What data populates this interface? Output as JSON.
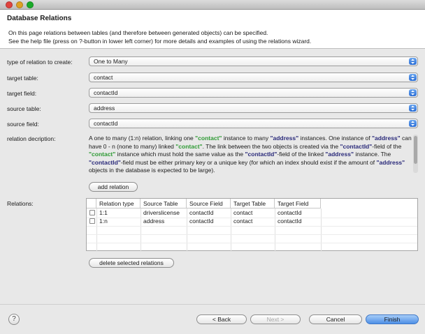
{
  "window": {
    "title": ""
  },
  "header": {
    "title": "Database Relations",
    "desc_line1": "On this page relations between tables (and therefore between generated objects) can be specified.",
    "desc_line2": "See the help file (press on ?-button in lower left corner) for more details and examples of using the relations wizard."
  },
  "form": {
    "relation_type": {
      "label": "type of relation to create:",
      "value": "One to Many"
    },
    "target_table": {
      "label": "target table:",
      "value": "contact"
    },
    "target_field": {
      "label": "target field:",
      "value": "contactId"
    },
    "source_table": {
      "label": "source table:",
      "value": "address"
    },
    "source_field": {
      "label": "source field:",
      "value": "contactId"
    },
    "description_label": "relation decription:"
  },
  "description": {
    "p1": "A one to many (1:n) relation, linking one ",
    "contact": "\"contact\"",
    "p2": " instance to many ",
    "address": "\"address\"",
    "p3": " instances. One instance of ",
    "p4": " can have 0 - n (none to many) linked ",
    "p5": ". The link between the two objects is created via the ",
    "contactid": "\"contactId\"",
    "p6": "-field of the ",
    "p7": " instance which must hold the same value as the ",
    "p8": "-field of the linked ",
    "p9": " instance. The ",
    "p10": "-field must be either primary key or a unique key (for which an index should exist if the amount of ",
    "p11": " objects in the database is expected to be large)."
  },
  "buttons": {
    "add_relation": "add relation",
    "delete_selected": "delete selected relations",
    "back": "< Back",
    "next": "Next >",
    "cancel": "Cancel",
    "finish": "Finish",
    "help": "?"
  },
  "relations": {
    "label": "Relations:",
    "columns": [
      "Relation type",
      "Source Table",
      "Source Field",
      "Target Table",
      "Target Field"
    ],
    "rows": [
      {
        "type": "1:1",
        "source_table": "driverslicense",
        "source_field": "contactId",
        "target_table": "contact",
        "target_field": "contactId"
      },
      {
        "type": "1:n",
        "source_table": "address",
        "source_field": "contactId",
        "target_table": "contact",
        "target_field": "contactId"
      }
    ]
  },
  "colors": {
    "accent": "#2c6fd6",
    "highlight_green": "#2e9a34",
    "highlight_blue": "#2a2a7a"
  }
}
